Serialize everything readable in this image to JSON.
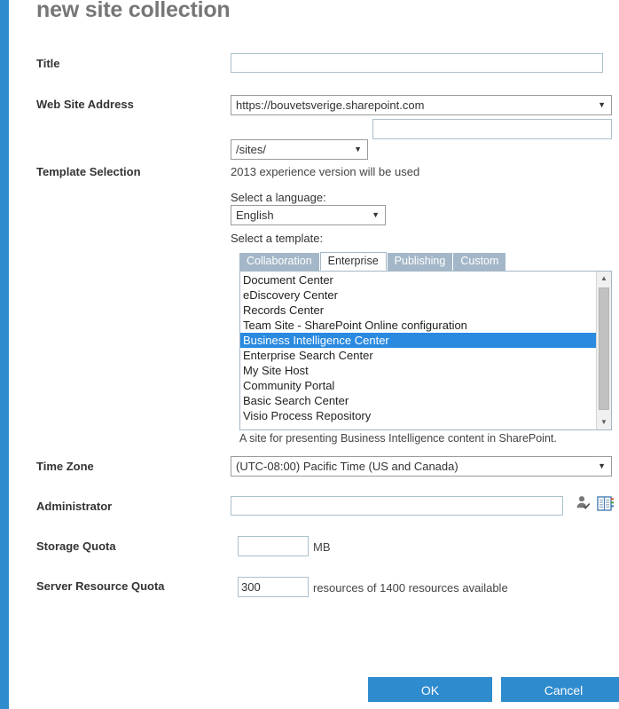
{
  "dialog": {
    "title": "new site collection",
    "accent_color": "#2e8bce"
  },
  "fields": {
    "title": {
      "label": "Title",
      "value": "",
      "placeholder": ""
    },
    "web_site_address": {
      "label": "Web Site Address",
      "host_value": "https://bouvetsverige.sharepoint.com",
      "path_value": "/sites/",
      "name_value": "",
      "name_placeholder": ""
    },
    "template_selection": {
      "label": "Template Selection",
      "experience_note": "2013 experience version will be used",
      "language_label": "Select a language:",
      "language_value": "English",
      "template_label": "Select a template:",
      "tabs": [
        {
          "label": "Collaboration",
          "active": false
        },
        {
          "label": "Enterprise",
          "active": true
        },
        {
          "label": "Publishing",
          "active": false
        },
        {
          "label": "Custom",
          "active": false
        }
      ],
      "templates": [
        {
          "label": "Document Center",
          "selected": false
        },
        {
          "label": "eDiscovery Center",
          "selected": false
        },
        {
          "label": "Records Center",
          "selected": false
        },
        {
          "label": "Team Site - SharePoint Online configuration",
          "selected": false
        },
        {
          "label": "Business Intelligence Center",
          "selected": true
        },
        {
          "label": "Enterprise Search Center",
          "selected": false
        },
        {
          "label": "My Site Host",
          "selected": false
        },
        {
          "label": "Community Portal",
          "selected": false
        },
        {
          "label": "Basic Search Center",
          "selected": false
        },
        {
          "label": "Visio Process Repository",
          "selected": false
        }
      ],
      "description": "A site for presenting Business Intelligence content in SharePoint.",
      "selection_color": "#2a8ae0"
    },
    "time_zone": {
      "label": "Time Zone",
      "value": "(UTC-08:00) Pacific Time (US and Canada)"
    },
    "administrator": {
      "label": "Administrator",
      "value": "",
      "placeholder": "",
      "check_names_icon": "person-check-icon",
      "address_book_icon": "address-book-icon"
    },
    "storage_quota": {
      "label": "Storage Quota",
      "value": "",
      "unit": "MB"
    },
    "server_resource_quota": {
      "label": "Server Resource Quota",
      "value": "300",
      "suffix": "resources of 1400 resources available"
    }
  },
  "footer": {
    "ok_label": "OK",
    "cancel_label": "Cancel",
    "button_color": "#2e8bce"
  },
  "icons": {
    "dropdown_arrow": "▼",
    "scroll_up_arrow": "▲",
    "scroll_down_arrow": "▼"
  }
}
